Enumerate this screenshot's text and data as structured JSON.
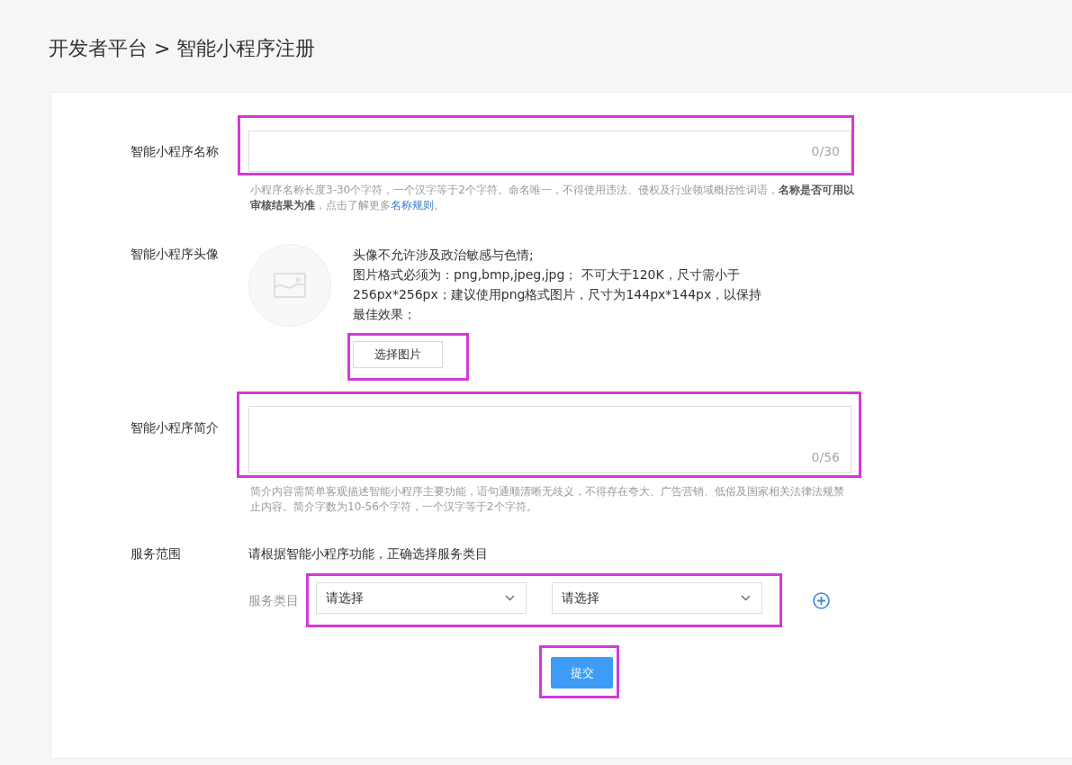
{
  "page_title": "开发者平台 > 智能小程序注册",
  "form": {
    "name_field": {
      "label": "智能小程序名称",
      "counter": "0/30",
      "highlighted": true,
      "hint": "小程序名称长度3-30个字符，一个汉字等于2个字符。命名唯一，不得使用违法、侵权及行业领域概括性词语，**名称是否可用以审核结果为准**，点击了解更多",
      "hint_link": "名称规则",
      "hint_tail": "。"
    },
    "avatar": {
      "label": "智能小程序头像",
      "notes": [
        "头像不允许涉及政治敏感与色情;",
        "图片格式必须为：png,bmp,jpeg,jpg； 不可大于120K，尺寸需小于256px*256px；建议使用png格式图片，尺寸为144px*144px，以保持最佳效果；"
      ],
      "button": {
        "label": "选择图片",
        "highlighted": true
      }
    },
    "intro_field": {
      "label": "智能小程序简介",
      "counter": "0/56",
      "highlighted": true,
      "hint": "简介内容需简单客观描述智能小程序主要功能，语句通顺清晰无歧义，不得存在夸大、广告营销、低俗及国家相关法律法规禁止内容。简介字数为10-56个字符，一个汉字等于2个字符。"
    },
    "service": {
      "label": "服务范围",
      "instruction": "请根据智能小程序功能，正确选择服务类目",
      "category_label": "服务类目",
      "highlighted": true,
      "selects": [
        {
          "value": "请选择"
        },
        {
          "value": "请选择"
        }
      ]
    },
    "submit": {
      "label": "提交",
      "highlighted": true
    }
  }
}
